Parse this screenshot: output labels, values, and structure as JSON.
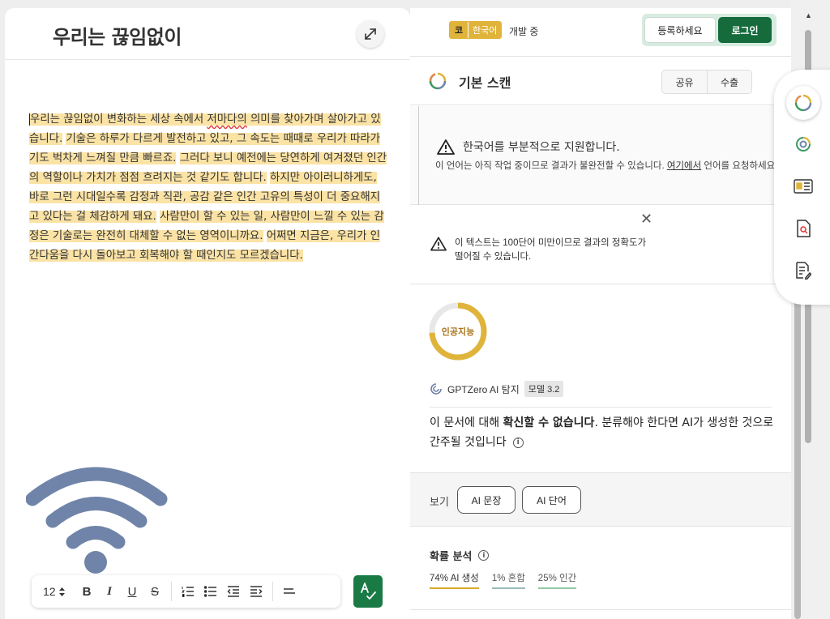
{
  "editor": {
    "title": "우리는 끊임없이",
    "paragraph": {
      "s1a": "우리는 끊임없이 변화하는 세상 속에서 ",
      "s1b": "저마다의",
      "s1c": " 의미를 찾아가며 살아가고 있습니다.",
      "s2": "기술은 하루가 다르게 발전하고 있고, 그 속도는 때때로 우리가 따라가기도 벅차게 느껴질 만큼 빠르죠.",
      "s3": "그러다 보니 예전에는 당연하게 여겨졌던 인간의 역할이나 가치가 점점 흐려지는 것 같기도 합니다.",
      "s4": "하지만 아이러니하게도, 바로 그런 시대일수록 감정과 직관, 공감 같은 인간 고유의 특성이 더 중요해지고 있다는 걸 체감하게 돼요.",
      "s5": "사람만이 할 수 있는 일, 사람만이 느낄 수 있는 감정은 기술로는 완전히 대체할 수 없는 영역이니까요.",
      "s6": "어쩌면 지금은, 우리가 인간다움을 다시 돌아보고 회복해야 할 때인지도 모르겠습니다."
    },
    "toolbar": {
      "font_size": "12"
    }
  },
  "header": {
    "lang_short": "코",
    "lang_full": "한국어",
    "dev_status": "개발 중",
    "signup": "등록하세요",
    "login": "로그인"
  },
  "scan": {
    "title": "기본 스캔",
    "share": "공유",
    "export": "수출"
  },
  "notice1": {
    "head": "한국어를 부분적으로 지원합니다.",
    "body_a": "이 언어는 아직 작업 중이므로 결과가 불완전할 수 있습니다. ",
    "body_link": "여기에서",
    "body_b": " 언어를 요청하세요."
  },
  "notice2": {
    "text": "이 텍스트는 100단어 미만이므로 결과의 정확도가 떨어질 수 있습니다."
  },
  "result": {
    "donut_label": "인공지능",
    "ai_fraction": 0.74,
    "detector": "GPTZero AI 탐지",
    "model": "모델 3.2",
    "verdict_a": "이 문서에 대해 ",
    "verdict_b": "확신할 수 없습니다",
    "verdict_c": ". 분류해야 한다면 AI가 생성한 것으로 간주될 것입니다",
    "view_label": "보기",
    "view_ai_sentence": "AI 문장",
    "view_ai_word": "AI 단어",
    "prob_title": "확률 분석",
    "prob_ai": "74% AI 생성",
    "prob_mixed": "1% 혼합",
    "prob_human": "25% 인간"
  },
  "colors": {
    "accent_green": "#156b3c",
    "highlight": "#fbe3a6",
    "ai_gold": "#e0b43a"
  }
}
